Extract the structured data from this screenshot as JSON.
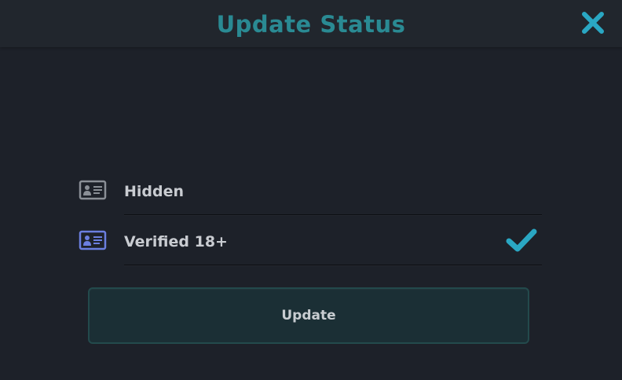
{
  "dialog": {
    "title": "Update Status",
    "close_icon": "close-icon"
  },
  "options": [
    {
      "label": "Hidden",
      "icon": "id-card-icon",
      "icon_color": "#8a8f96",
      "selected": false
    },
    {
      "label": "Verified 18+",
      "icon": "id-card-icon",
      "icon_color": "#6b7fe0",
      "selected": true
    }
  ],
  "actions": {
    "update_label": "Update"
  },
  "colors": {
    "accent": "#2a8a93",
    "check": "#2aa7c3",
    "close": "#2aa7c3",
    "background": "#1d2129"
  }
}
